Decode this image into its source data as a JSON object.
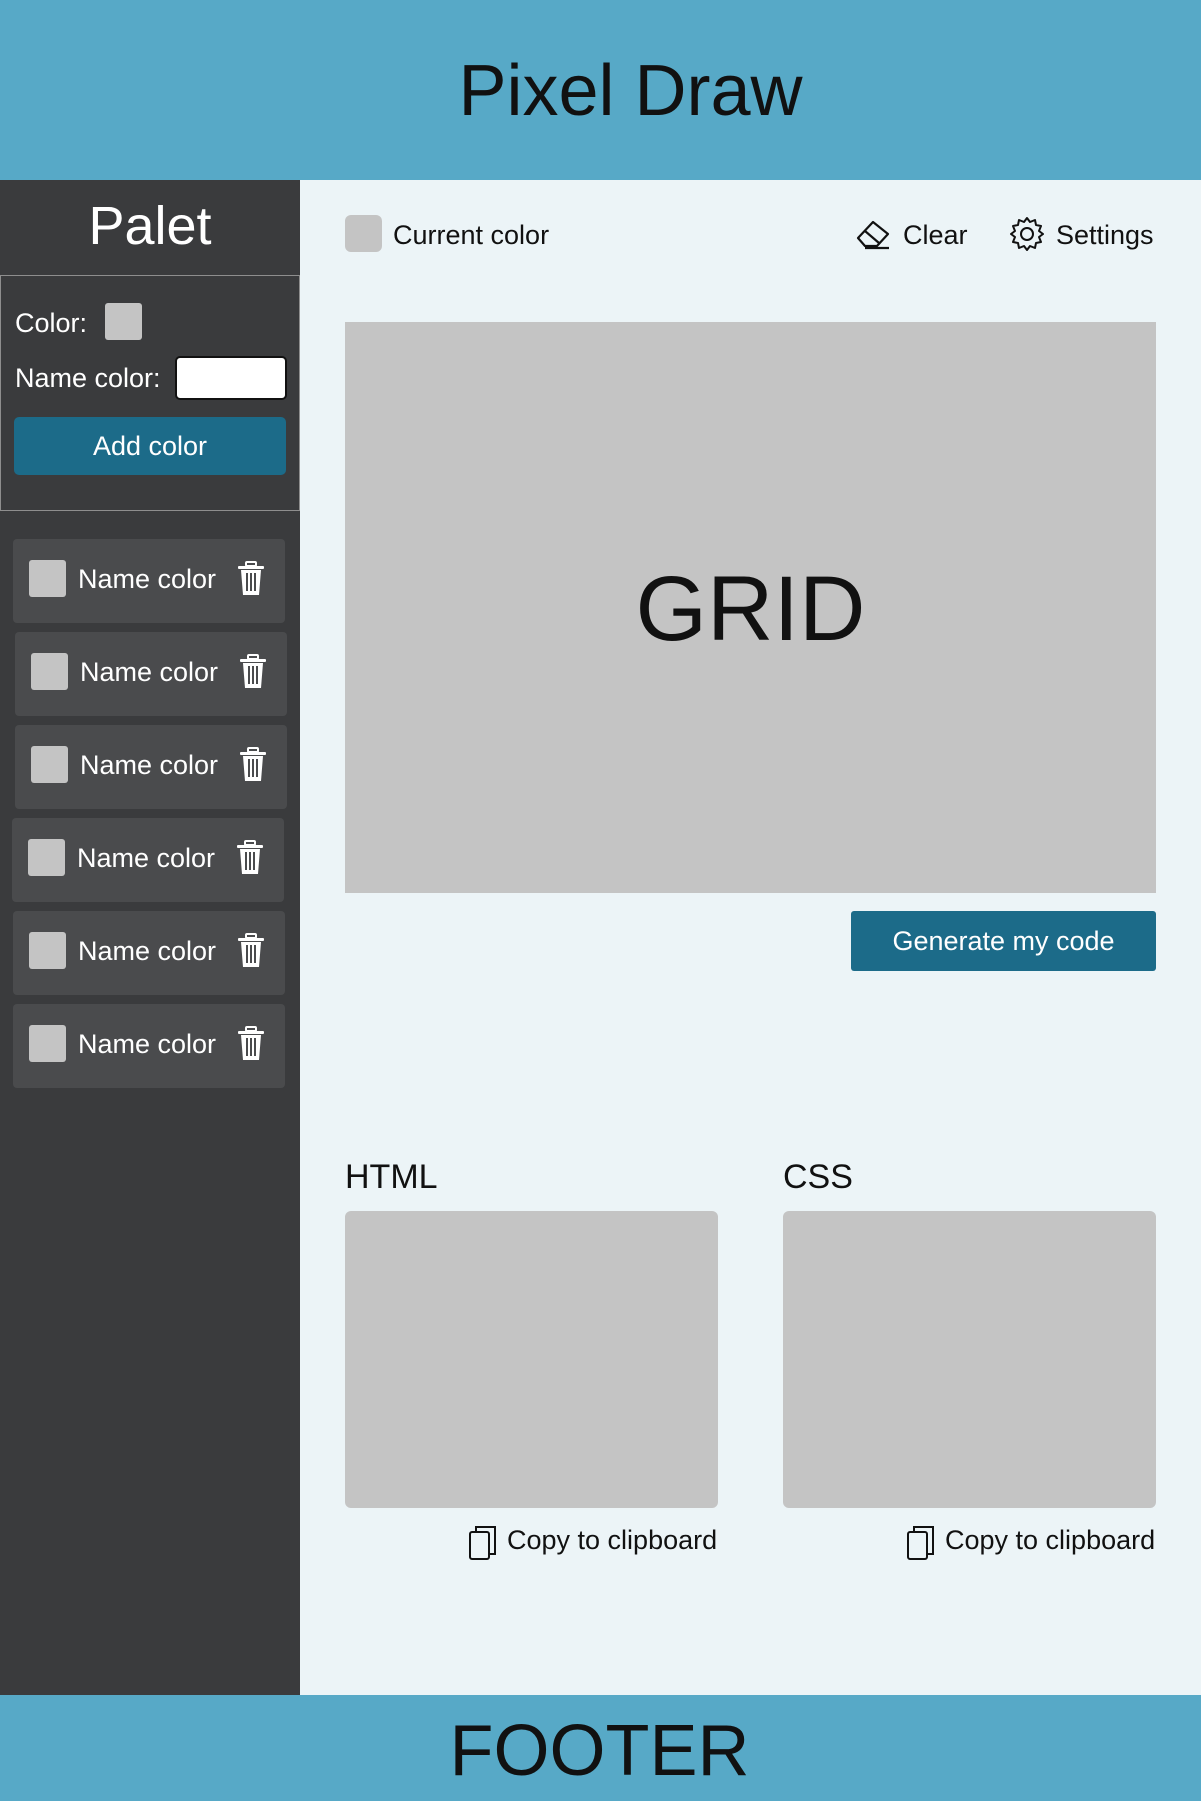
{
  "app": {
    "title": "Pixel Draw"
  },
  "sidebar": {
    "title": "Palet",
    "add_form": {
      "color_label": "Color:",
      "name_label": "Name color:",
      "name_value": "",
      "add_button": "Add color"
    },
    "items": [
      {
        "name": "Name color"
      },
      {
        "name": "Name color"
      },
      {
        "name": "Name color"
      },
      {
        "name": "Name color"
      },
      {
        "name": "Name color"
      },
      {
        "name": "Name color"
      }
    ]
  },
  "toolbar": {
    "current_color_label": "Current color",
    "clear_label": "Clear",
    "settings_label": "Settings"
  },
  "main": {
    "grid_label": "GRID",
    "generate_button": "Generate my code",
    "html_title": "HTML",
    "css_title": "CSS",
    "copy_label": "Copy to clipboard"
  },
  "footer": {
    "text": "FOOTER"
  },
  "colors": {
    "header": "#57A9C7",
    "sidebar": "#3A3B3D",
    "accent": "#1C6B89",
    "placeholder": "#C4C4C4",
    "background": "#ECF4F7"
  }
}
